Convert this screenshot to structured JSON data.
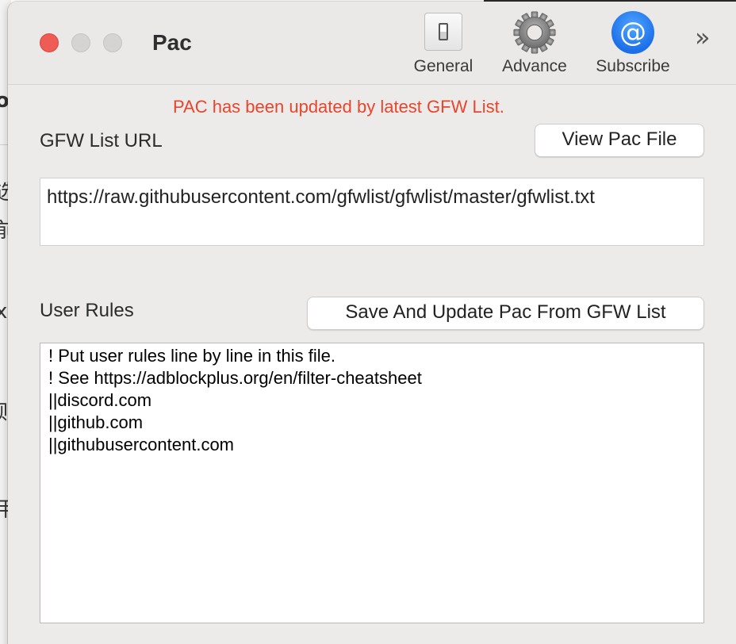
{
  "window": {
    "title": "Pac"
  },
  "toolbar": {
    "items": [
      {
        "label": "General",
        "icon": "toggle-switch-icon"
      },
      {
        "label": "Advance",
        "icon": "gear-icon"
      },
      {
        "label": "Subscribe",
        "icon": "at-sign-icon"
      }
    ],
    "overflow_glyph": "»"
  },
  "status_message": "PAC has been updated by latest GFW List.",
  "gfw_list": {
    "label": "GFW List URL",
    "url": "https://raw.githubusercontent.com/gfwlist/gfwlist/master/gfwlist.txt",
    "view_button": "View Pac File"
  },
  "user_rules": {
    "label": "User Rules",
    "save_button": "Save And Update Pac From GFW List",
    "lines": [
      "! Put user rules line by line in this file.",
      "! See https://adblockplus.org/en/filter-cheatsheet",
      "||discord.com",
      "||github.com",
      "||githubusercontent.com"
    ]
  },
  "colors": {
    "status_text": "#e8452c",
    "close_button": "#ee5c55",
    "subscribe_icon": "#1d6fe8"
  }
}
